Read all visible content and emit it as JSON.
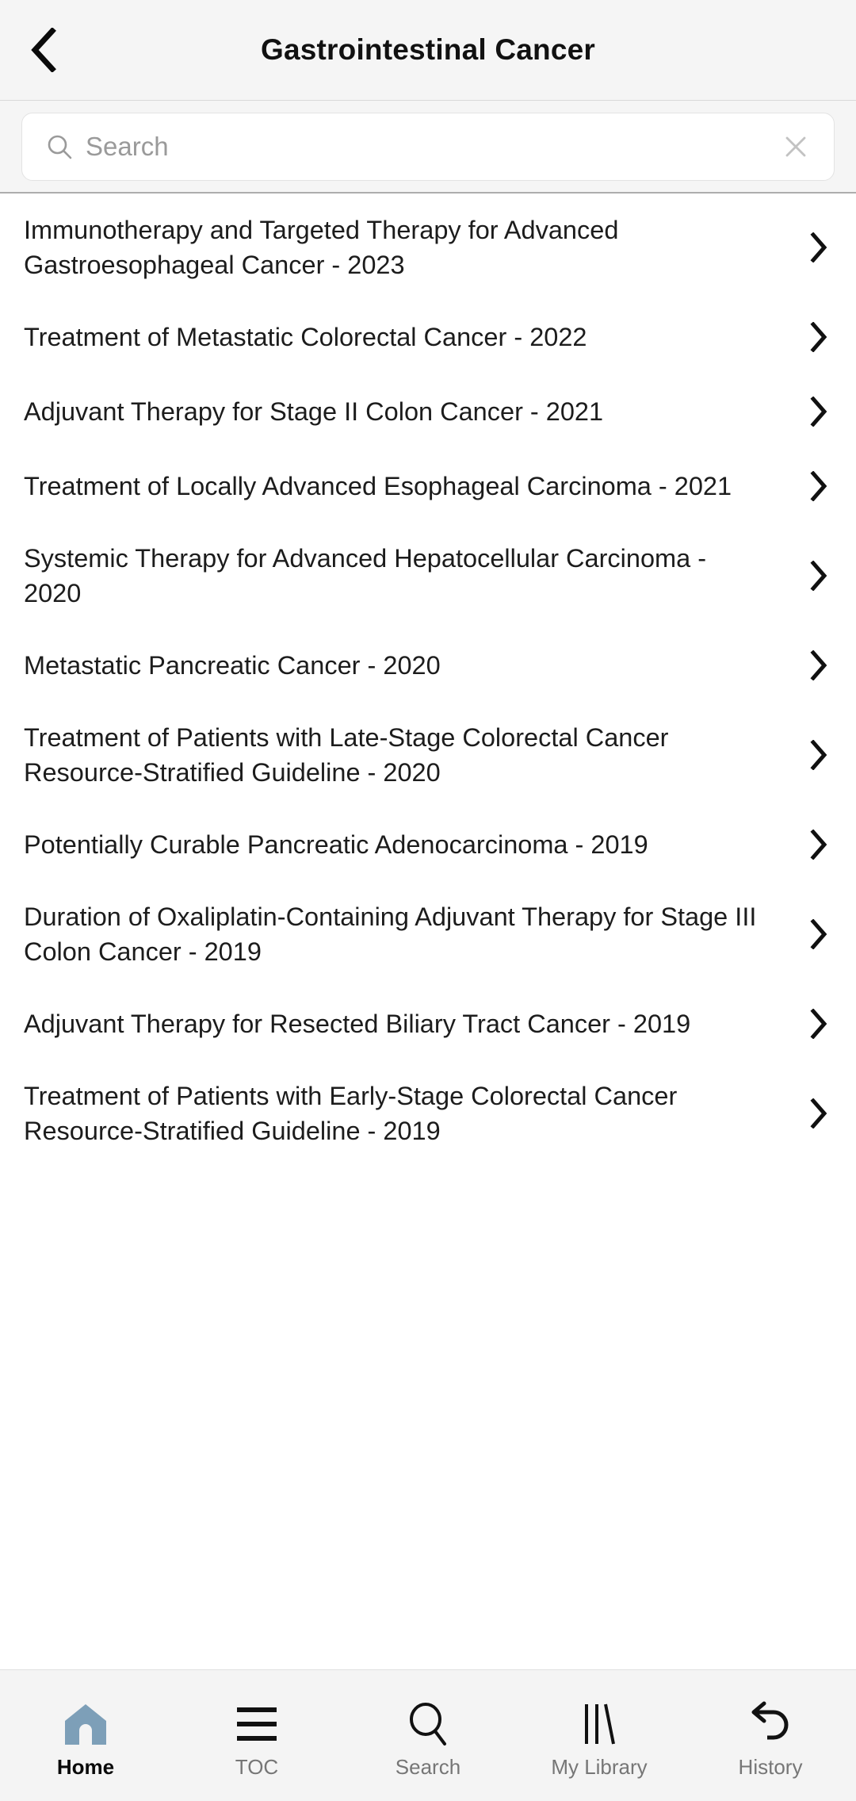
{
  "header": {
    "title": "Gastrointestinal Cancer",
    "back_icon": "chevron-left-icon"
  },
  "search": {
    "placeholder": "Search",
    "value": "",
    "icon": "search-icon",
    "clear_icon": "close-icon"
  },
  "list": {
    "items": [
      {
        "label": "Immunotherapy and Targeted Therapy for Advanced Gastroesophageal Cancer - 2023",
        "chevron": "chevron-right-icon"
      },
      {
        "label": "Treatment of Metastatic Colorectal Cancer - 2022",
        "chevron": "chevron-right-icon"
      },
      {
        "label": "Adjuvant Therapy for Stage II Colon Cancer - 2021",
        "chevron": "chevron-right-icon"
      },
      {
        "label": "Treatment of Locally Advanced Esophageal Carcinoma - 2021",
        "chevron": "chevron-right-icon"
      },
      {
        "label": "Systemic Therapy for Advanced Hepatocellular Carcinoma - 2020",
        "chevron": "chevron-right-icon"
      },
      {
        "label": "Metastatic Pancreatic Cancer - 2020",
        "chevron": "chevron-right-icon"
      },
      {
        "label": "Treatment of Patients with Late-Stage Colorectal Cancer Resource-Stratified Guideline - 2020",
        "chevron": "chevron-right-icon"
      },
      {
        "label": "Potentially Curable Pancreatic Adenocarcinoma - 2019",
        "chevron": "chevron-right-icon"
      },
      {
        "label": "Duration of Oxaliplatin-Containing Adjuvant Therapy for Stage III Colon Cancer - 2019",
        "chevron": "chevron-right-icon"
      },
      {
        "label": "Adjuvant Therapy for Resected Biliary Tract Cancer - 2019",
        "chevron": "chevron-right-icon"
      },
      {
        "label": "Treatment of Patients with Early-Stage Colorectal Cancer Resource-Stratified Guideline - 2019",
        "chevron": "chevron-right-icon"
      }
    ]
  },
  "bottom_nav": {
    "items": [
      {
        "label": "Home",
        "icon": "home-icon",
        "active": true
      },
      {
        "label": "TOC",
        "icon": "list-lines-icon",
        "active": false
      },
      {
        "label": "Search",
        "icon": "search-icon",
        "active": false
      },
      {
        "label": "My Library",
        "icon": "books-icon",
        "active": false
      },
      {
        "label": "History",
        "icon": "undo-arrow-icon",
        "active": false
      }
    ]
  },
  "colors": {
    "header_bg": "#f5f5f5",
    "nav_bg": "#f4f4f4",
    "active_icon": "#7d9fb8",
    "text_primary": "#1c1c1c",
    "text_muted": "#767676",
    "placeholder": "#9a9a9a"
  }
}
